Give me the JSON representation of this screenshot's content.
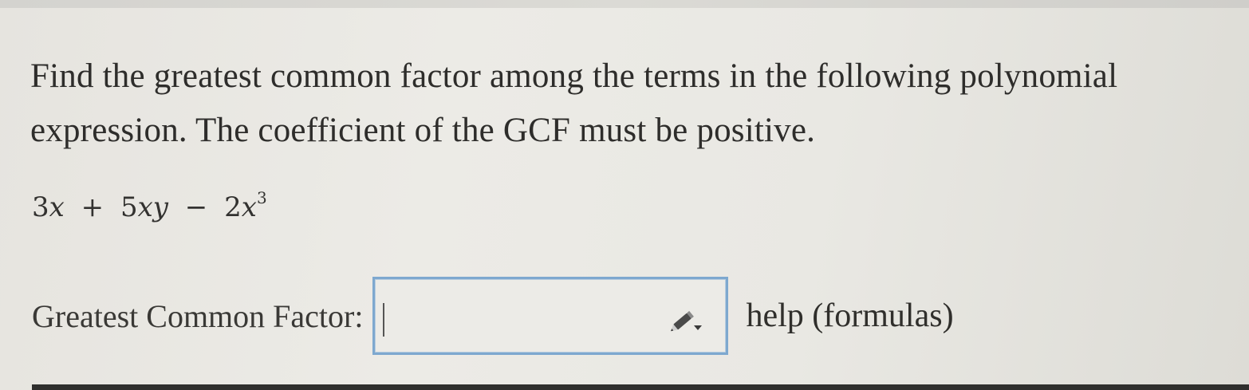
{
  "problem": {
    "line1": "Find the greatest common factor among the terms in the following polynomial",
    "line2": "expression. The coefficient of the GCF must be positive."
  },
  "expression": {
    "term1_coef": "3",
    "term1_var": "x",
    "op1": "+",
    "term2_coef": "5",
    "term2_var": "xy",
    "op2": "−",
    "term3_coef": "2",
    "term3_var": "x",
    "term3_exp": "3"
  },
  "answer": {
    "label": "Greatest Common Factor:",
    "value": "",
    "placeholder": "",
    "editor_icon": "pencil-dropdown-icon"
  },
  "help": {
    "label": "help (formulas)"
  },
  "colors": {
    "input_border": "#7ea8cf",
    "text": "#2e2d2b"
  }
}
